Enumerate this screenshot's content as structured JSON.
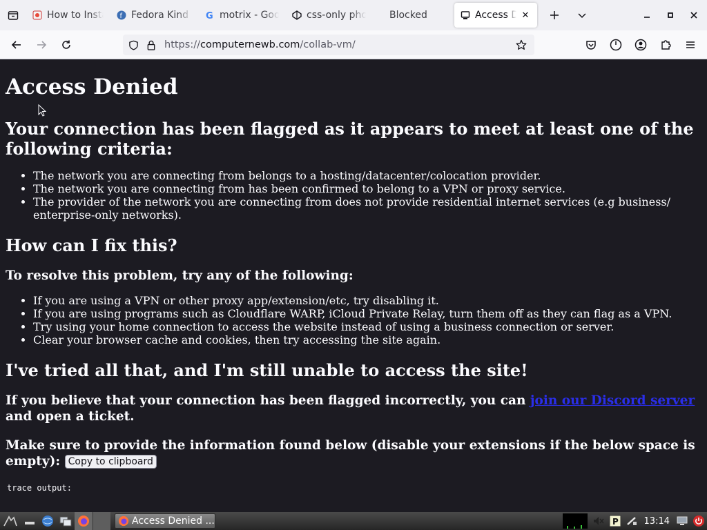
{
  "browser": {
    "tabs": [
      {
        "title": "How to Insta",
        "icon": "cloud-favicon",
        "active": false
      },
      {
        "title": "Fedora Kind",
        "icon": "fedora-favicon",
        "active": false
      },
      {
        "title": "motrix - Goo",
        "icon": "google-favicon",
        "active": false
      },
      {
        "title": "css-only pho",
        "icon": "codepen-favicon",
        "active": false
      },
      {
        "title": "Blocked",
        "icon": "",
        "active": false
      },
      {
        "title": "Access Den",
        "icon": "collabvm-favicon",
        "active": true
      }
    ],
    "url": {
      "scheme": "https://",
      "host": "computernewb.com",
      "path": "/collab-vm/"
    }
  },
  "page": {
    "title": "Access Denied",
    "flagged_heading": "Your connection has been flagged as it appears to meet at least one of the following criteria:",
    "criteria": [
      "The network you are connecting from belongs to a hosting/datacenter/colocation provider.",
      "The network you are connecting from has been confirmed to belong to a VPN or proxy service.",
      "The provider of the network you are connecting from does not provide residential internet services (e.g business/ enterprise-only networks)."
    ],
    "fix_heading": "How can I fix this?",
    "resolve_heading": "To resolve this problem, try any of the following:",
    "fixes": [
      "If you are using a VPN or other proxy app/extension/etc, try disabling it.",
      "If you are using programs such as Cloudflare WARP, iCloud Private Relay, turn them off as they can flag as a VPN.",
      "Try using your home connection to access the website instead of using a business connection or server.",
      "Clear your browser cache and cookies, then try accessing the site again."
    ],
    "tried_heading": "I've tried all that, and I'm still unable to access the site!",
    "believe_prefix": "If you believe that your connection has been flagged incorrectly, you can ",
    "discord_link": "join our Discord server",
    "believe_suffix": " and open a ticket.",
    "provide_text": "Make sure to provide the information found below (disable your extensions if the below space is empty): ",
    "copy_button": "Copy to clipboard",
    "trace_label": "trace output:"
  },
  "taskbar": {
    "task_title": "Access Denied ...",
    "clock": "13:14"
  },
  "colors": {
    "page_bg": "#1c1b22",
    "page_text": "#fbfbfe",
    "link": "#2a2ee8",
    "tabstrip_bg": "#f0f0f4",
    "navbar_bg": "#f9f9fb"
  }
}
